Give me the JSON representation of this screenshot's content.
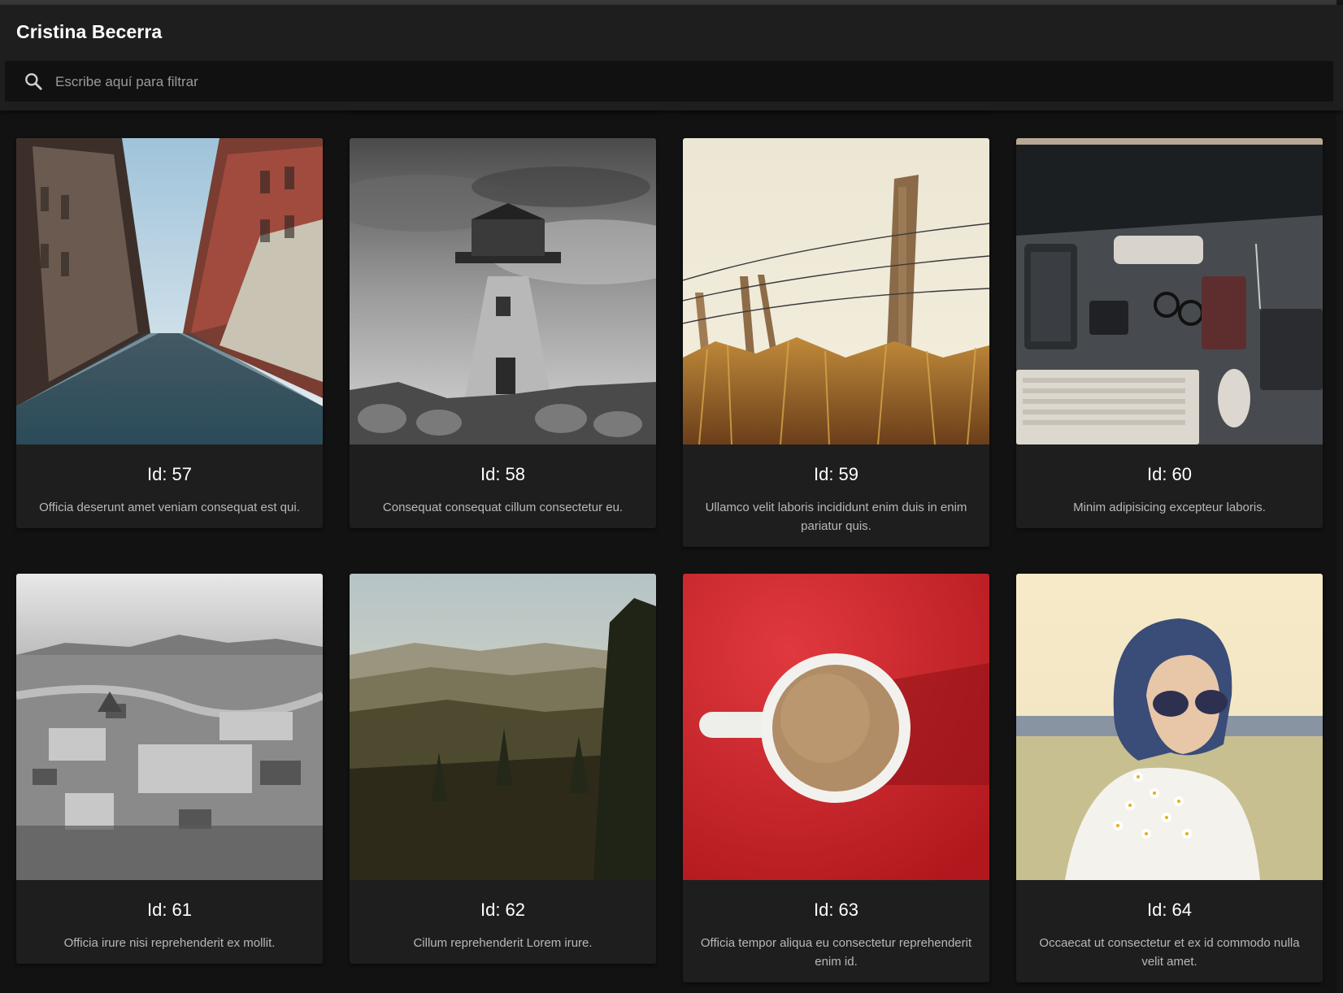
{
  "header": {
    "title": "Cristina Becerra",
    "search": {
      "placeholder": "Escribe aquí para filtrar",
      "value": "",
      "icon": "search-icon"
    }
  },
  "cards": [
    {
      "id_label": "Id: 57",
      "description": "Officia deserunt amet veniam consequat est qui.",
      "image": "city-street-photo"
    },
    {
      "id_label": "Id: 58",
      "description": "Consequat consequat cillum consectetur eu.",
      "image": "lighthouse-photo"
    },
    {
      "id_label": "Id: 59",
      "description": "Ullamco velit laboris incididunt enim duis in enim pariatur quis.",
      "image": "fence-post-photo"
    },
    {
      "id_label": "Id: 60",
      "description": "Minim adipisicing excepteur laboris.",
      "image": "desk-workspace-photo"
    },
    {
      "id_label": "Id: 61",
      "description": "Officia irure nisi reprehenderit ex mollit.",
      "image": "city-aerial-photo"
    },
    {
      "id_label": "Id: 62",
      "description": "Cillum reprehenderit Lorem irure.",
      "image": "hills-landscape-photo"
    },
    {
      "id_label": "Id: 63",
      "description": "Officia tempor aliqua eu consectetur reprehenderit enim id.",
      "image": "coffee-cup-photo"
    },
    {
      "id_label": "Id: 64",
      "description": "Occaecat ut consectetur et ex id commodo nulla velit amet.",
      "image": "woman-flowers-photo"
    }
  ]
}
